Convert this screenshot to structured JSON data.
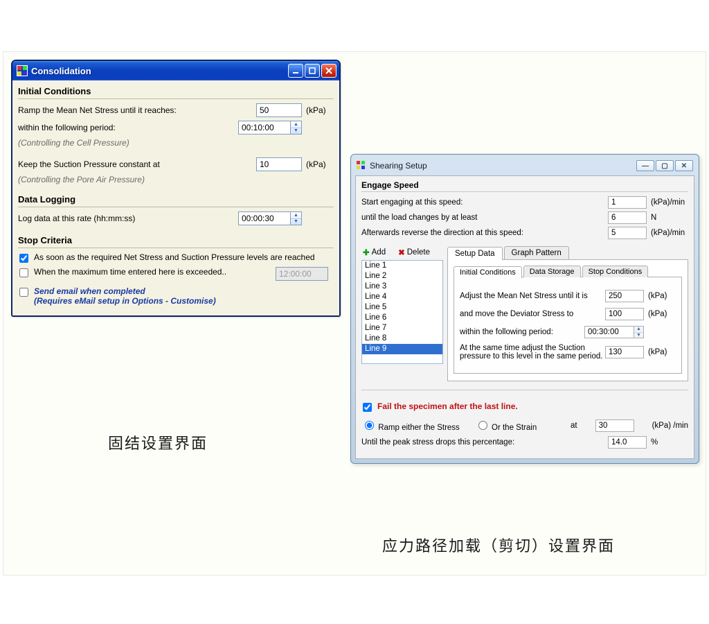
{
  "consolidation": {
    "title": "Consolidation",
    "sections": {
      "initial": {
        "heading": "Initial Conditions",
        "ramp_label": "Ramp the Mean Net Stress until it reaches:",
        "ramp_value": "50",
        "ramp_unit": "(kPa)",
        "period_label": "within the following period:",
        "period_value": "00:10:00",
        "cell_note": "(Controlling the Cell Pressure)",
        "suction_label": "Keep the Suction Pressure constant at",
        "suction_value": "10",
        "suction_unit": "(kPa)",
        "pore_note": "(Controlling the Pore Air Pressure)"
      },
      "logging": {
        "heading": "Data Logging",
        "rate_label": "Log data at this rate (hh:mm:ss)",
        "rate_value": "00:00:30"
      },
      "stop": {
        "heading": "Stop Criteria",
        "opt1": "As soon as the required Net Stress and Suction Pressure levels are reached",
        "opt2": "When the maximum time entered here is exceeded..",
        "opt2_value": "12:00:00",
        "email_line": "Send email when completed\n(Requires eMail setup in Options - Customise)"
      }
    },
    "caption": "固结设置界面"
  },
  "shearing": {
    "title": "Shearing Setup",
    "engage": {
      "heading": "Engage Speed",
      "l1": "Start engaging at this speed:",
      "v1": "1",
      "u1": "(kPa)/min",
      "l2": "until the load changes by at least",
      "v2": "6",
      "u2": "N",
      "l3": "Afterwards reverse the direction at this speed:",
      "v3": "5",
      "u3": "(kPa)/min"
    },
    "toolbar": {
      "add": "Add",
      "delete": "Delete"
    },
    "lines": [
      "Line 1",
      "Line 2",
      "Line 3",
      "Line 4",
      "Line 5",
      "Line 6",
      "Line 7",
      "Line 8",
      "Line 9"
    ],
    "selected_line_index": 8,
    "tabs": {
      "setup": "Setup Data",
      "graph": "Graph Pattern"
    },
    "innertabs": {
      "ic": "Initial Conditions",
      "ds": "Data Storage",
      "sc": "Stop Conditions"
    },
    "ic": {
      "l1": "Adjust the Mean Net Stress until it is",
      "v1": "250",
      "u1": "(kPa)",
      "l2": "and move the Deviator Stress to",
      "v2": "100",
      "u2": "(kPa)",
      "l3": "within the following period:",
      "v3": "00:30:00",
      "l4": "At the same time adjust the Suction pressure to this level in the same period.",
      "v4": "130",
      "u4": "(kPa)"
    },
    "fail": {
      "chk_label": "Fail the specimen after the last line.",
      "radio_stress": "Ramp either the Stress",
      "radio_strain": "Or the Strain",
      "at_label": "at",
      "at_value": "30",
      "at_unit": "(kPa) /min",
      "until_label": "Until the peak stress drops this percentage:",
      "until_value": "14.0",
      "until_unit": "%"
    },
    "caption": "应力路径加载（剪切）设置界面"
  }
}
